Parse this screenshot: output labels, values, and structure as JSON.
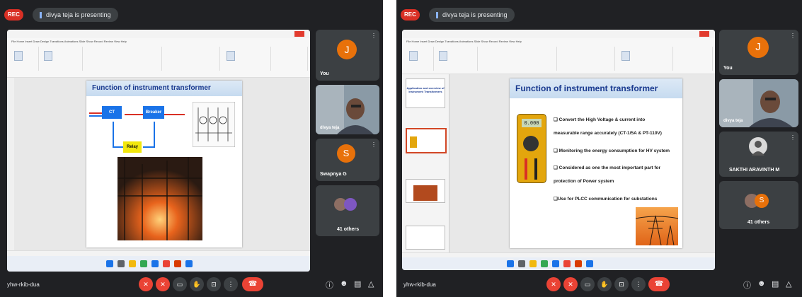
{
  "left": {
    "rec_label": "REC",
    "presenting_text": "divya teja is presenting",
    "ribbon_tabs": "File  Home  Insert  Draw  Design  Transitions  Animations  Slide Show  Record  Review  View  Help",
    "slide_title": "Function of instrument transformer",
    "diagram": {
      "ct": "CT",
      "breaker": "Breaker",
      "relay": "Relay"
    },
    "tiles": [
      {
        "initial": "J",
        "name": "You",
        "color": "#e8710a"
      },
      {
        "initial": "",
        "name": "divya teja",
        "color": "#5f6368"
      },
      {
        "initial": "S",
        "name": "Swapnya G",
        "color": "#e8710a"
      },
      {
        "initial": "",
        "name": "41 others",
        "color": "#5f6368"
      }
    ],
    "meet_code": "yhw-rkib-dua"
  },
  "right": {
    "rec_label": "REC",
    "presenting_text": "divya teja is presenting",
    "ribbon_tabs": "File  Home  Insert  Draw  Design  Transitions  Animations  Slide Show  Record  Review  View  Help",
    "slide_title": "Function of instrument transformer",
    "bullets": [
      "❑ Convert the High Voltage & current into",
      "measurable range accurately (CT-1/5A & PT-110V)",
      "❑ Monitoring the energy consumption for HV system",
      "❑ Considered as one the most important part for",
      "protection of Power system",
      "❑Use for PLCC communication for substations"
    ],
    "thumb1_title": "Application and overview of Instrument Transformers",
    "meter_reading": "0.000",
    "tiles": [
      {
        "initial": "J",
        "name": "You",
        "color": "#e8710a"
      },
      {
        "initial": "",
        "name": "divya teja",
        "color": "#5f6368"
      },
      {
        "initial": "",
        "name": "SAKTHI ARAVINTH M",
        "color": "#5f6368"
      },
      {
        "initial": "S",
        "name": "41 others",
        "color": "#e8710a"
      }
    ],
    "meet_code": "yhw-rkib-dua"
  }
}
